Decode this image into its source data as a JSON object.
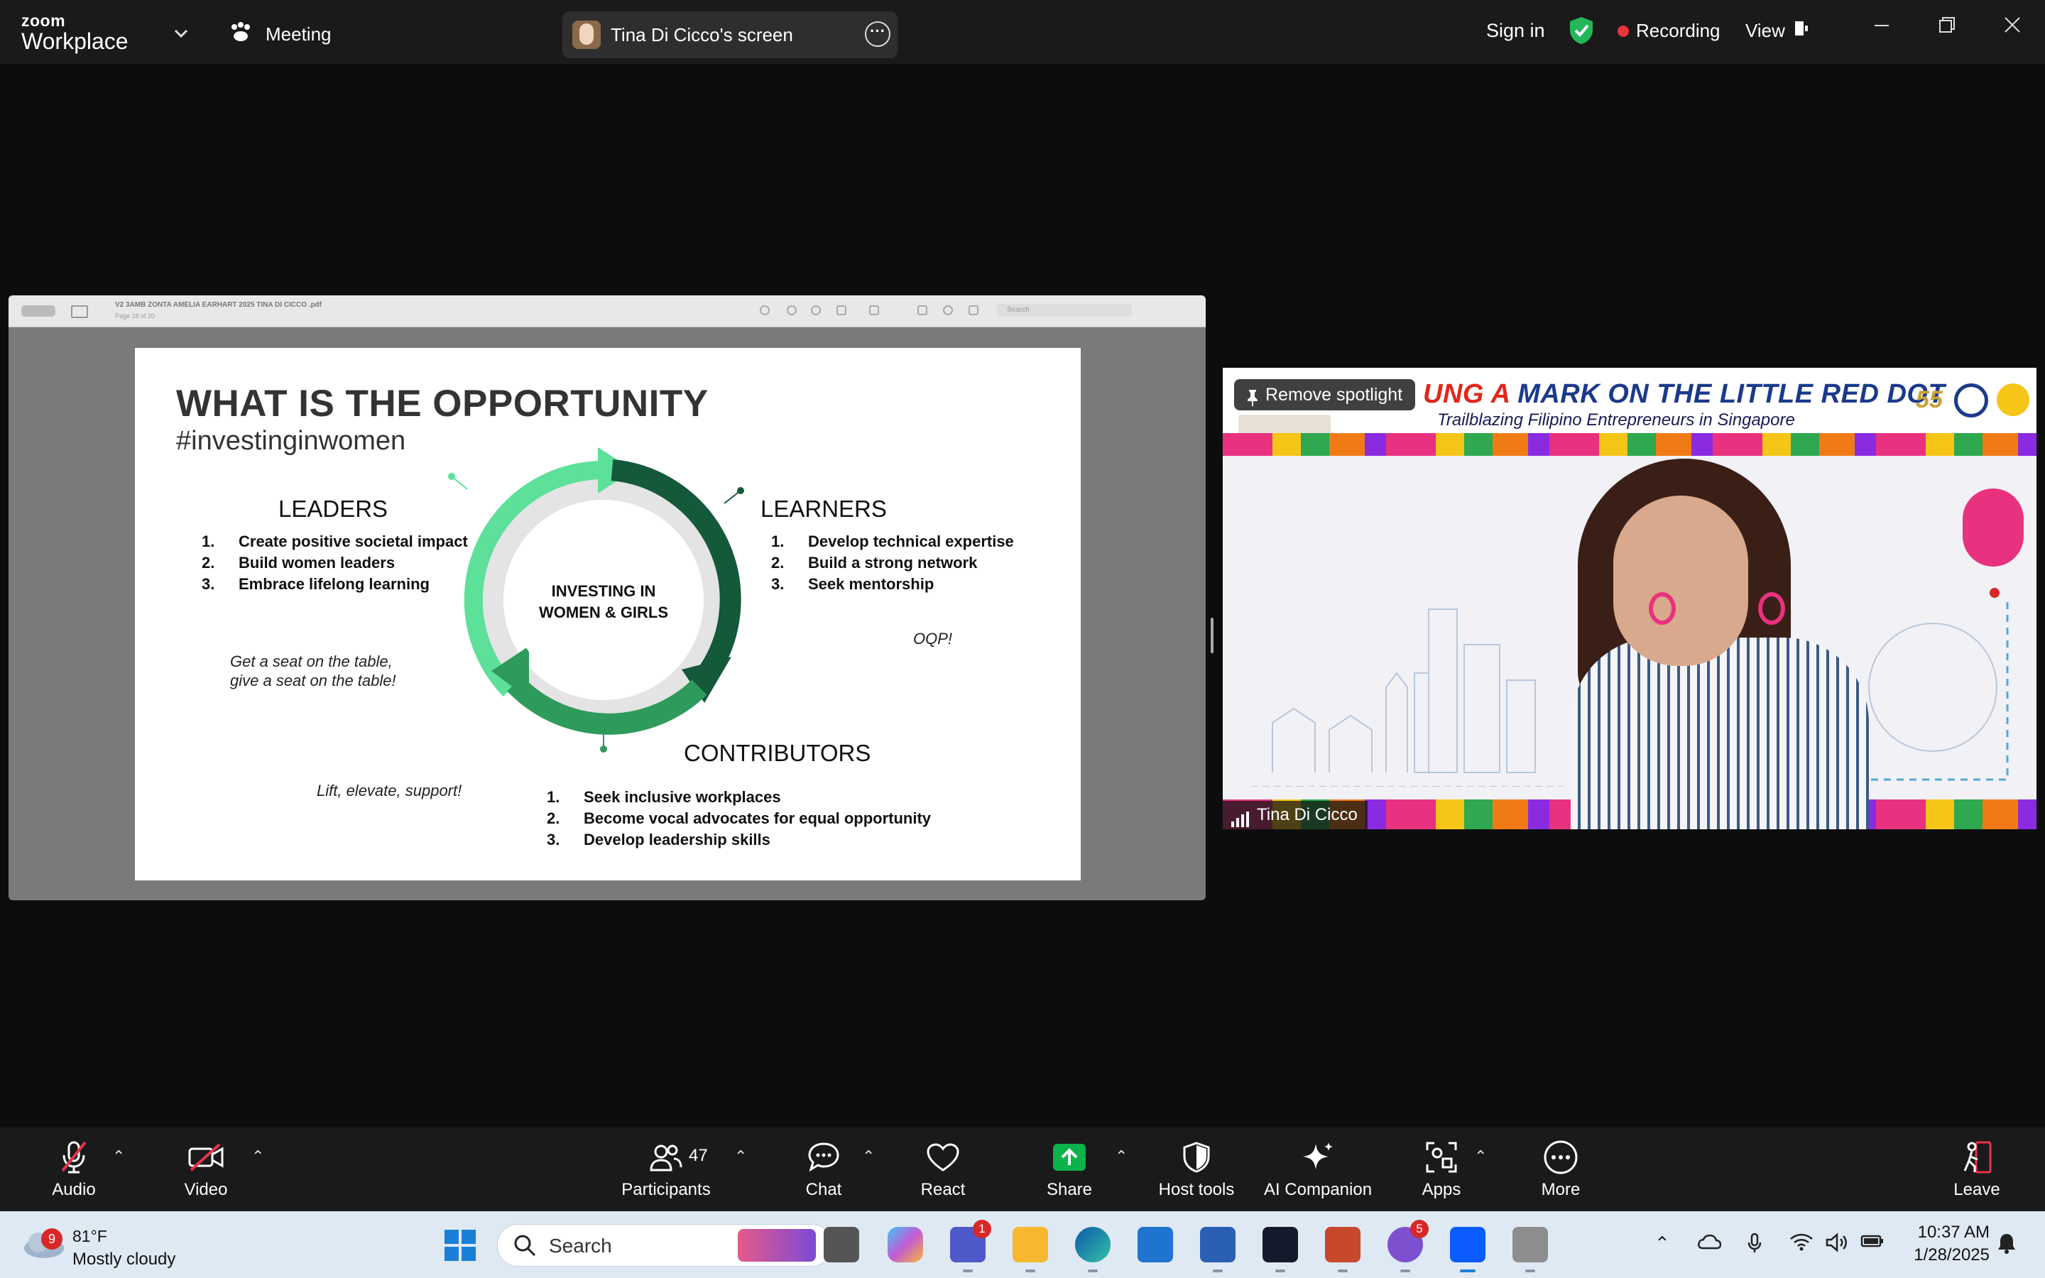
{
  "topbar": {
    "logo_line1": "zoom",
    "logo_line2": "Workplace",
    "meeting_label": "Meeting",
    "screen_share_name": "Tina Di Cicco's screen",
    "sign_in": "Sign in",
    "recording": "Recording",
    "view": "View"
  },
  "pdf": {
    "filename": "V2 3AMB ZONTA AMELIA EARHART 2025 TINA DI CICCO .pdf",
    "page_indicator": "Page 18 of 20",
    "search_placeholder": "Search"
  },
  "slide": {
    "title": "WHAT IS THE OPPORTUNITY",
    "hashtag": "#investinginwomen",
    "center_line1": "INVESTING IN",
    "center_line2": "WOMEN & GIRLS",
    "leaders": {
      "title": "LEADERS",
      "items": [
        {
          "n": "1.",
          "text": "Create positive societal impact"
        },
        {
          "n": "2.",
          "text": "Build women leaders"
        },
        {
          "n": "3.",
          "text": "Embrace lifelong learning"
        }
      ],
      "quote_line1": "Get a seat on the table,",
      "quote_line2": "give a seat on the table!"
    },
    "learners": {
      "title": "LEARNERS",
      "items": [
        {
          "n": "1.",
          "text": "Develop technical expertise"
        },
        {
          "n": "2.",
          "text": "Build a strong network"
        },
        {
          "n": "3.",
          "text": "Seek mentorship"
        }
      ],
      "quote": "OQP!"
    },
    "contributors": {
      "title": "CONTRIBUTORS",
      "items": [
        {
          "n": "1.",
          "text": "Seek inclusive workplaces"
        },
        {
          "n": "2.",
          "text": "Become vocal advocates for equal opportunity"
        },
        {
          "n": "3.",
          "text": "Develop leadership skills"
        }
      ],
      "quote": "Lift, elevate, support!"
    },
    "colors": {
      "light_green": "#5de09a",
      "mid_green": "#2e9a5c",
      "dark_green": "#14593a",
      "ring_gray": "#e4e4e4"
    }
  },
  "video": {
    "banner_title_prefix": "UNG A ",
    "banner_title_highlight": "MARK ON THE LITTLE RED DOT",
    "banner_subtitle": "Trailblazing  Filipino Entrepreneurs in Singapore",
    "banner_badge": "55",
    "remove_spotlight": "Remove spotlight",
    "participant_name": "Tina Di Cicco"
  },
  "toolbar": {
    "audio": "Audio",
    "video": "Video",
    "participants": "Participants",
    "participants_count": "47",
    "chat": "Chat",
    "react": "React",
    "share": "Share",
    "host_tools": "Host tools",
    "ai_companion": "AI Companion",
    "apps": "Apps",
    "more": "More",
    "leave": "Leave",
    "share_color": "#0bb34b",
    "muted_color": "#e5334b"
  },
  "taskbar": {
    "weather_badge": "9",
    "temperature": "81°F",
    "condition": "Mostly cloudy",
    "search_text": "Search",
    "teams_badge": "1",
    "viber_badge": "5",
    "time": "10:37 AM",
    "date": "1/28/2025"
  }
}
